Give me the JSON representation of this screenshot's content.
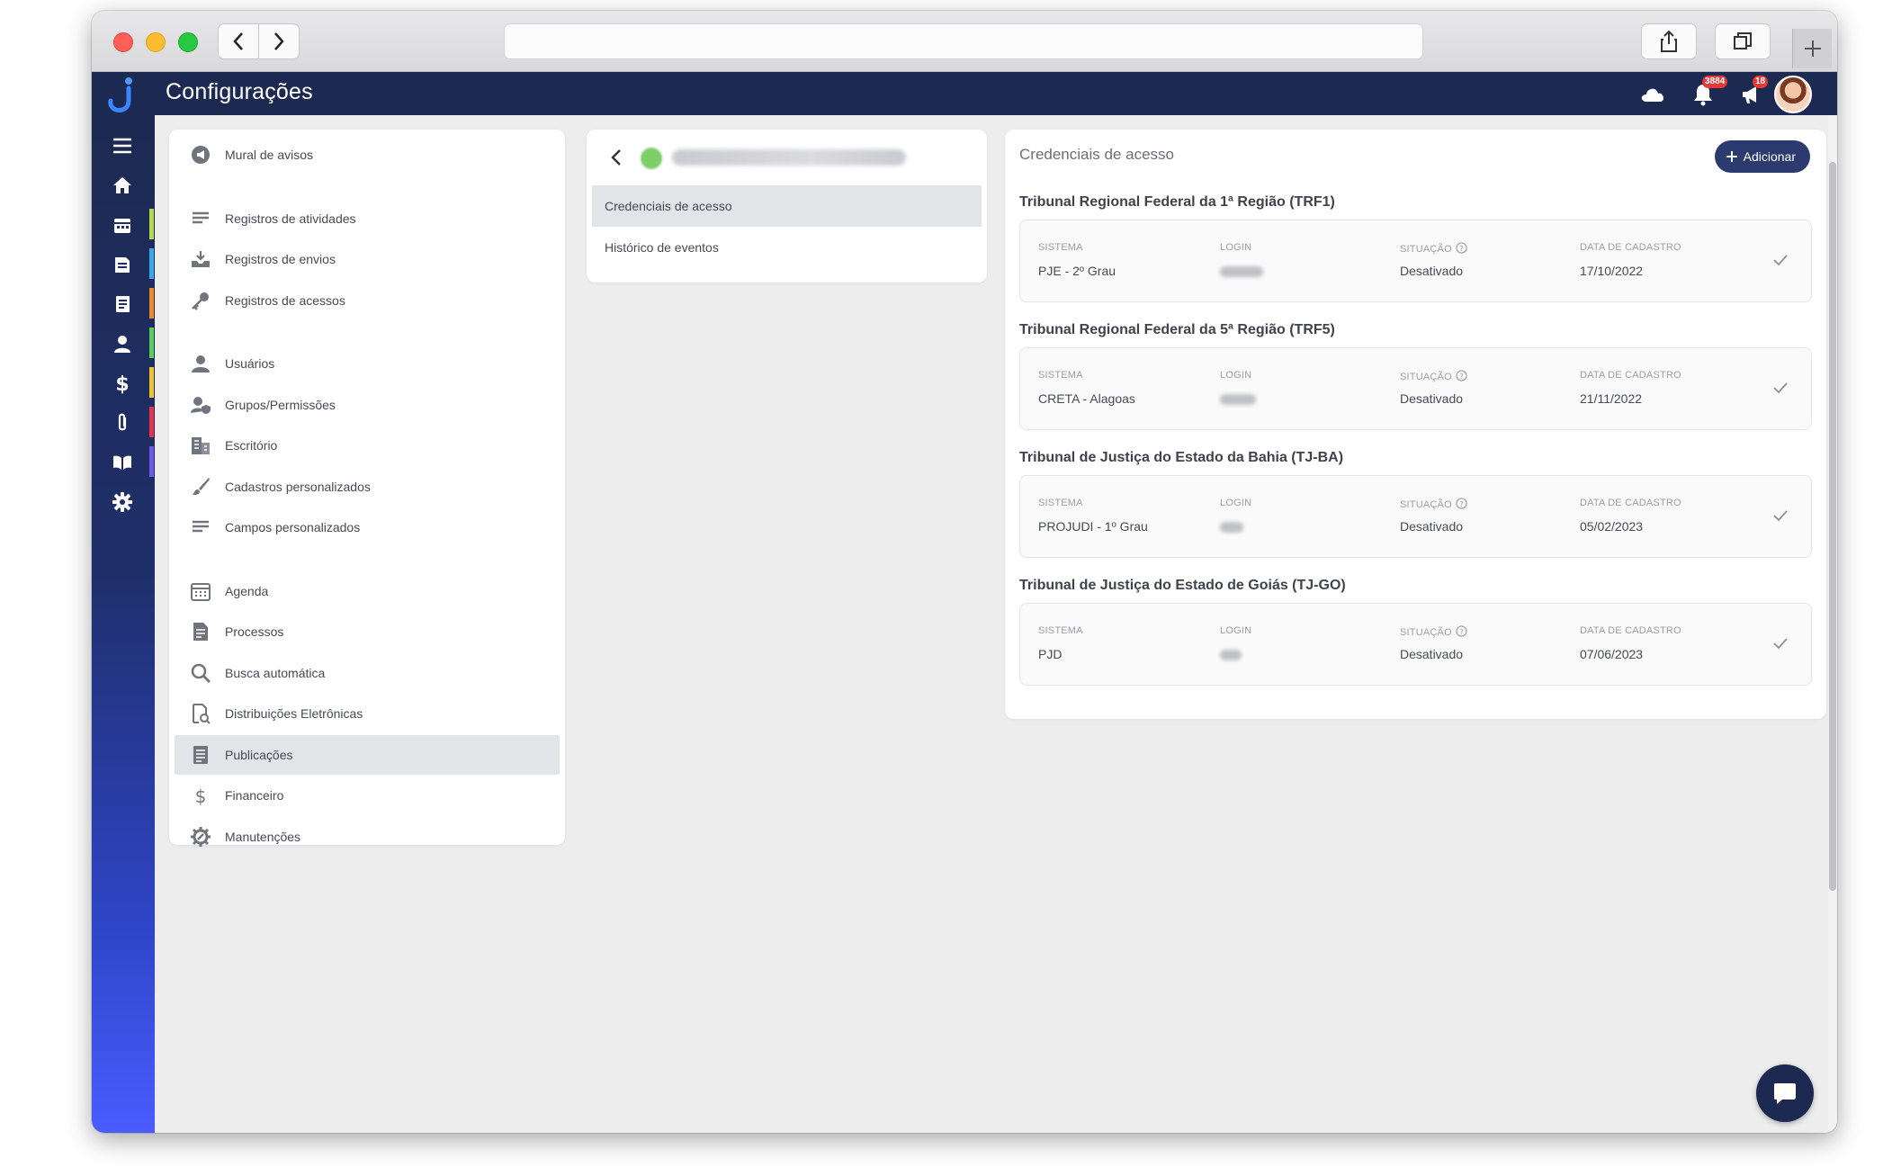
{
  "app": {
    "title": "Configurações",
    "notifications_count": "3884",
    "alerts_count": "18"
  },
  "sidebar_colors": [
    "#b6d94a",
    "#39a9e8",
    "#f08a24",
    "#5ccf5a",
    "#f2c12e",
    "#e5334b",
    "#6b5ce7",
    "#e83e8c"
  ],
  "menu": {
    "items": [
      {
        "label": "Mural de avisos",
        "icon": "megaphone-icon"
      },
      {
        "label": "Registros de atividades",
        "icon": "list-icon"
      },
      {
        "label": "Registros de envios",
        "icon": "inbox-icon"
      },
      {
        "label": "Registros de acessos",
        "icon": "key-icon"
      },
      {
        "label": "Usuários",
        "icon": "user-icon"
      },
      {
        "label": "Grupos/Permissões",
        "icon": "user-shield-icon"
      },
      {
        "label": "Escritório",
        "icon": "building-icon"
      },
      {
        "label": "Cadastros personalizados",
        "icon": "brush-icon"
      },
      {
        "label": "Campos personalizados",
        "icon": "fields-icon"
      },
      {
        "label": "Agenda",
        "icon": "calendar-icon"
      },
      {
        "label": "Processos",
        "icon": "folder-icon"
      },
      {
        "label": "Busca automática",
        "icon": "search-icon"
      },
      {
        "label": "Distribuições Eletrônicas",
        "icon": "document-search-icon"
      },
      {
        "label": "Publicações",
        "icon": "newspaper-icon"
      },
      {
        "label": "Financeiro",
        "icon": "dollar-icon"
      },
      {
        "label": "Manutenções",
        "icon": "gear-wrench-icon"
      }
    ],
    "active": "Publicações"
  },
  "client_panel": {
    "items": [
      {
        "label": "Credenciais de acesso"
      },
      {
        "label": "Histórico de eventos"
      }
    ],
    "active": "Credenciais de acesso"
  },
  "credentials": {
    "title": "Credenciais de acesso",
    "add_label": "Adicionar",
    "columns": {
      "system": "SISTEMA",
      "login": "LOGIN",
      "status": "SITUAÇÃO",
      "date": "DATA DE CADASTRO"
    },
    "entries": [
      {
        "court": "Tribunal Regional Federal da 1ª Região (TRF1)",
        "system": "PJE - 2º Grau",
        "status": "Desativado",
        "date": "17/10/2022"
      },
      {
        "court": "Tribunal Regional Federal da 5ª Região (TRF5)",
        "system": "CRETA - Alagoas",
        "status": "Desativado",
        "date": "21/11/2022"
      },
      {
        "court": "Tribunal de Justiça do Estado da Bahia (TJ-BA)",
        "system": "PROJUDI - 1º Grau",
        "status": "Desativado",
        "date": "05/02/2023"
      },
      {
        "court": "Tribunal de Justiça do Estado de Goiás (TJ-GO)",
        "system": "PJD",
        "status": "Desativado",
        "date": "07/06/2023"
      }
    ]
  }
}
